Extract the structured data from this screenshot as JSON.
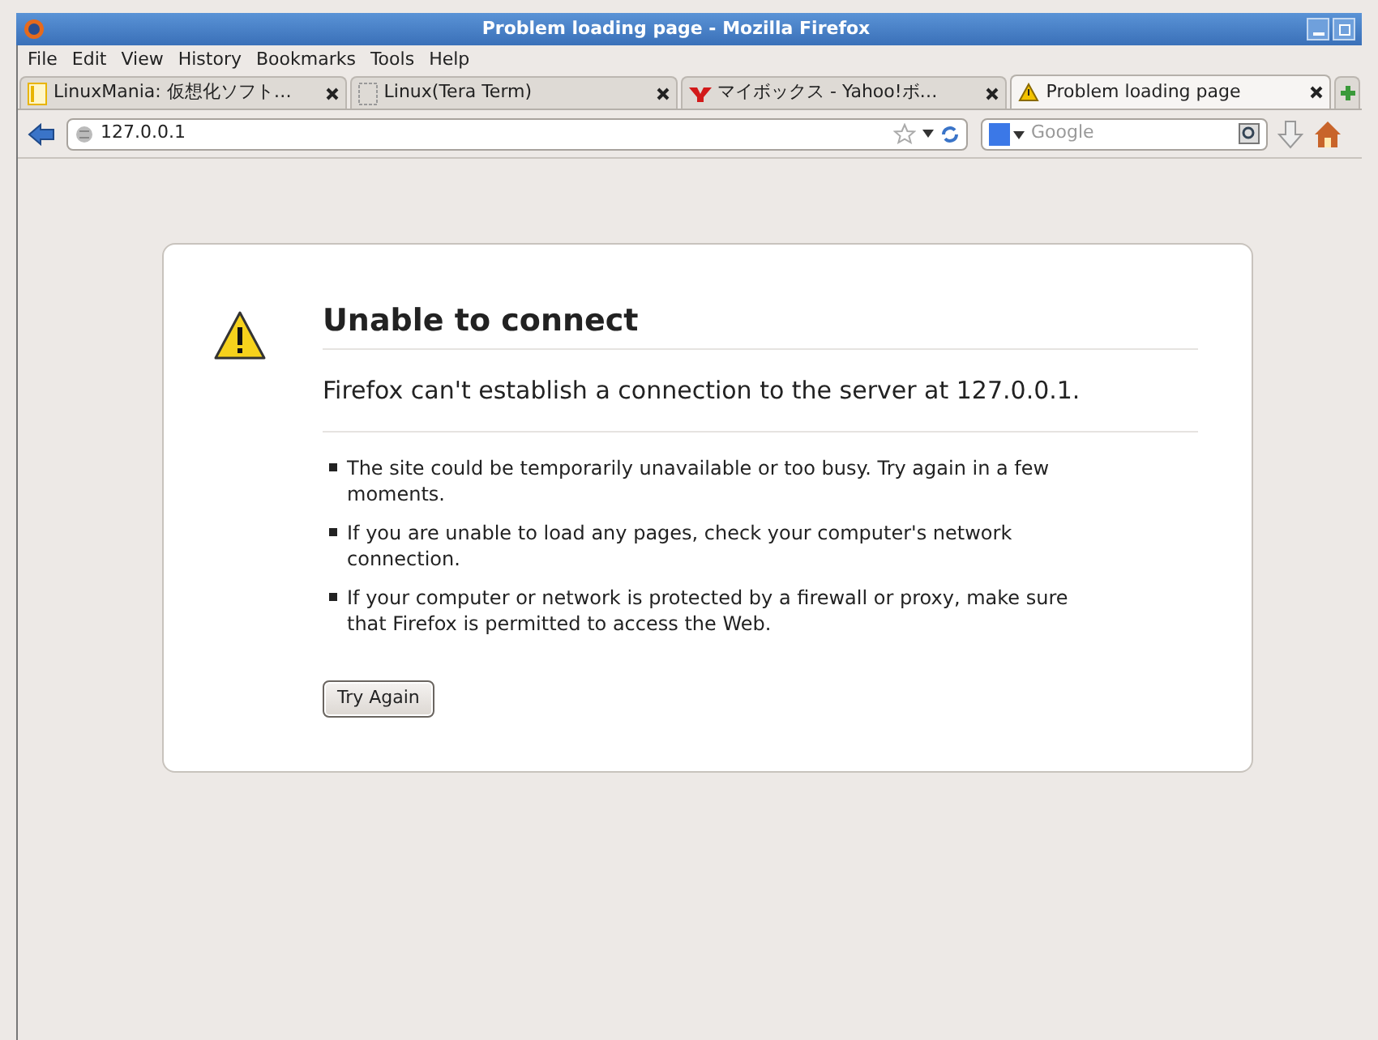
{
  "window": {
    "title": "Problem loading page - Mozilla Firefox"
  },
  "menu": [
    "File",
    "Edit",
    "View",
    "History",
    "Bookmarks",
    "Tools",
    "Help"
  ],
  "tabs": [
    {
      "label": "LinuxMania: 仮想化ソフト…",
      "kind": "page",
      "selected": false
    },
    {
      "label": "Linux(Tera Term)",
      "kind": "blank",
      "selected": false
    },
    {
      "label": "マイボックス - Yahoo!ボ…",
      "kind": "yahoo",
      "selected": false
    },
    {
      "label": "Problem loading page",
      "kind": "warning",
      "selected": true
    }
  ],
  "address": {
    "value": "127.0.0.1"
  },
  "search": {
    "placeholder": "Google"
  },
  "error": {
    "title": "Unable to connect",
    "message": "Firefox can't establish a connection to the server at 127.0.0.1.",
    "bullets": [
      "The site could be temporarily unavailable or too busy. Try again in a few moments.",
      "If you are unable to load any pages, check your computer's network connection.",
      "If your computer or network is protected by a firewall or proxy, make sure that Firefox is permitted to access the Web."
    ],
    "button": "Try Again"
  }
}
